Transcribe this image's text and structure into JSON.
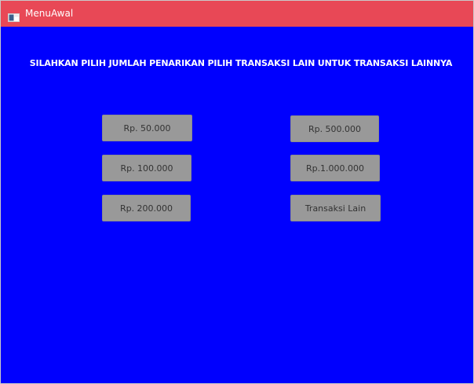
{
  "window": {
    "title": "MenuAwal",
    "icon": "java-app-icon"
  },
  "heading": "SILAHKAN PILIH JUMLAH PENARIKAN PILIH TRANSAKSI LAIN UNTUK TRANSAKSI LAINNYA",
  "buttons": {
    "left": [
      "Rp. 50.000",
      "Rp. 100.000",
      "Rp. 200.000"
    ],
    "right": [
      "Rp. 500.000",
      "Rp.1.000.000",
      "Transaksi Lain"
    ]
  },
  "colors": {
    "titlebar": "#e84856",
    "background": "#0000fe",
    "button": "#999999"
  }
}
